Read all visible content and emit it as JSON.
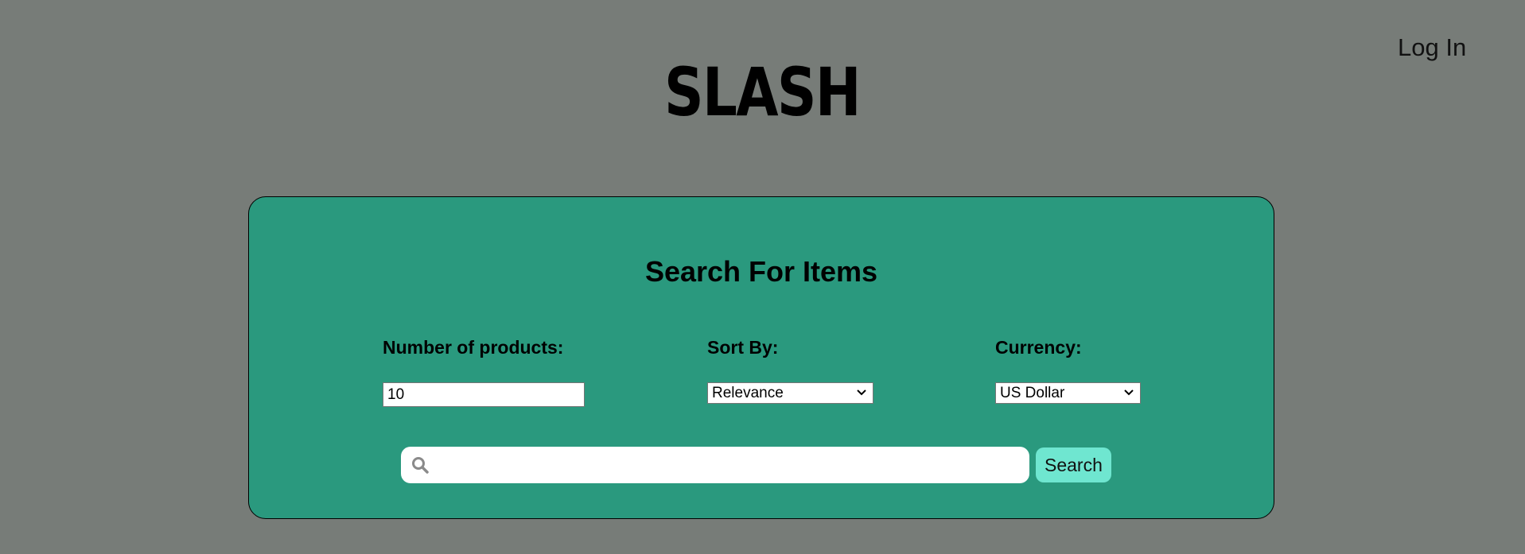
{
  "header": {
    "logo_text": "SLASH",
    "login_label": "Log In"
  },
  "search_panel": {
    "title": "Search For Items",
    "products": {
      "label": "Number of products:",
      "value": "10"
    },
    "sort": {
      "label": "Sort By:",
      "selected": "Relevance"
    },
    "currency": {
      "label": "Currency:",
      "selected": "US Dollar"
    },
    "search": {
      "placeholder": "",
      "button_label": "Search",
      "icon": "search-icon"
    }
  },
  "colors": {
    "page_background": "#777c78",
    "panel_background": "#2a997e",
    "search_button": "#6fe6d0"
  }
}
